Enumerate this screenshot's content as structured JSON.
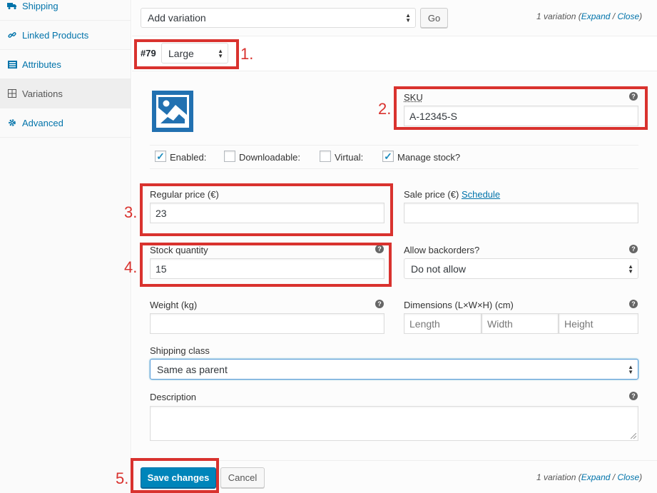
{
  "sidebar": {
    "items": [
      {
        "label": "Shipping",
        "icon": "truck-icon"
      },
      {
        "label": "Linked Products",
        "icon": "link-icon"
      },
      {
        "label": "Attributes",
        "icon": "list-icon"
      },
      {
        "label": "Variations",
        "icon": "grid-icon",
        "active": true
      },
      {
        "label": "Advanced",
        "icon": "gear-icon"
      }
    ]
  },
  "toolbar": {
    "action_select": "Add variation",
    "go_label": "Go",
    "count_text": "1 variation",
    "expand_label": "Expand",
    "divider": "/",
    "close_label": "Close"
  },
  "variation": {
    "id": "#79",
    "size_value": "Large"
  },
  "fields": {
    "sku_label": "SKU",
    "sku_value": "A-12345-S",
    "enabled_label": "Enabled:",
    "downloadable_label": "Downloadable:",
    "virtual_label": "Virtual:",
    "manage_stock_label": "Manage stock?",
    "regular_price_label": "Regular price (€)",
    "regular_price_value": "23",
    "sale_price_label": "Sale price (€)",
    "schedule_label": "Schedule",
    "stock_qty_label": "Stock quantity",
    "stock_qty_value": "15",
    "backorders_label": "Allow backorders?",
    "backorders_value": "Do not allow",
    "weight_label": "Weight (kg)",
    "dimensions_label": "Dimensions (L×W×H) (cm)",
    "length_placeholder": "Length",
    "width_placeholder": "Width",
    "height_placeholder": "Height",
    "shipping_class_label": "Shipping class",
    "shipping_class_value": "Same as parent",
    "description_label": "Description",
    "help_glyph": "?"
  },
  "checkboxes": {
    "enabled": true,
    "downloadable": false,
    "virtual": false,
    "manage_stock": true
  },
  "footer": {
    "save_label": "Save changes",
    "cancel_label": "Cancel"
  },
  "annotations": {
    "n1": "1.",
    "n2": "2.",
    "n3": "3.",
    "n4": "4.",
    "n5": "5."
  },
  "colors": {
    "accent": "#0073aa",
    "primary_button": "#0085ba",
    "annotation_red": "#d9322e",
    "image_icon": "#2271b1"
  }
}
